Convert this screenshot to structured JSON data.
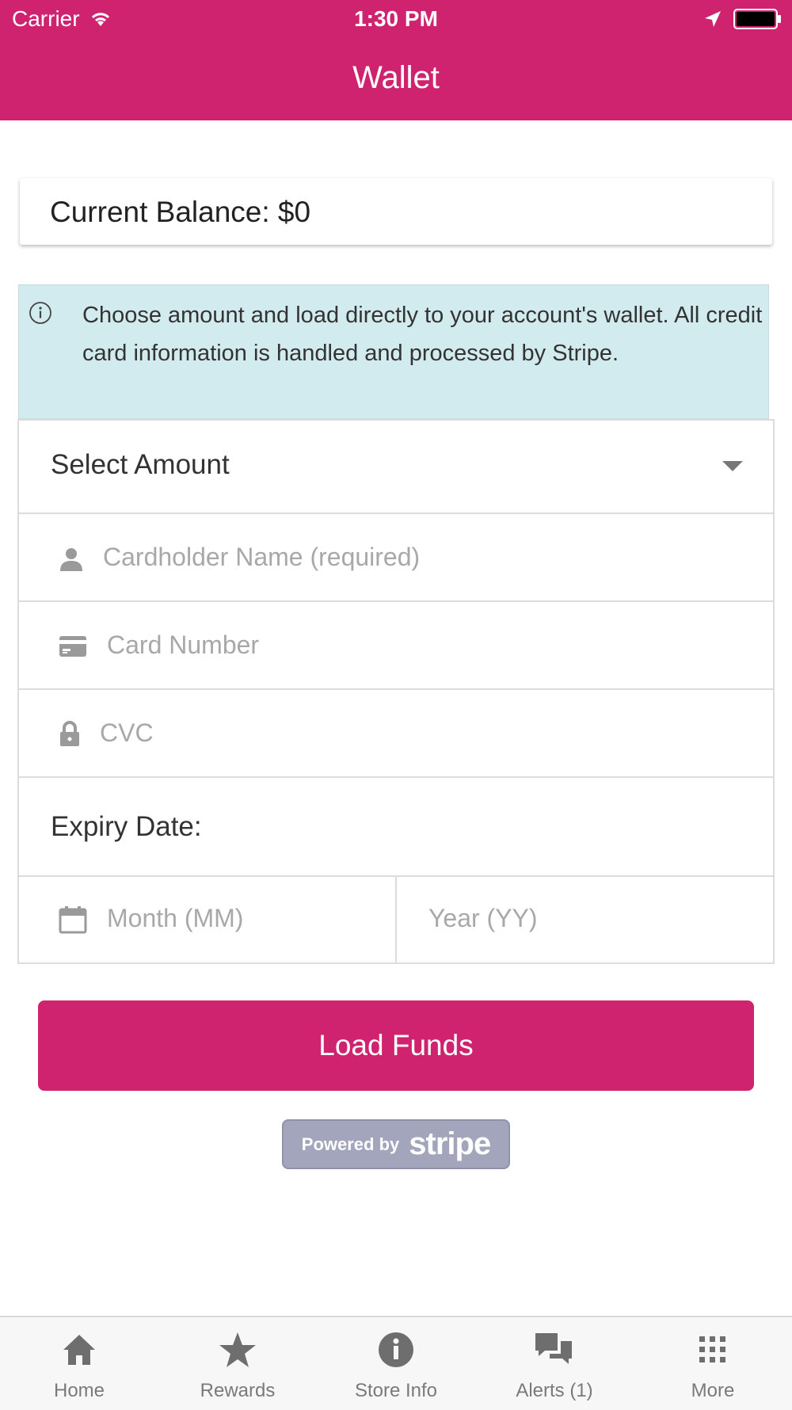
{
  "status_bar": {
    "carrier": "Carrier",
    "time": "1:30 PM"
  },
  "nav": {
    "title": "Wallet"
  },
  "balance": {
    "text": "Current Balance: $0"
  },
  "info": {
    "icon": "info-circle-icon",
    "text": "Choose amount and load directly to your account's wallet. All credit card information is handled and processed by Stripe."
  },
  "form": {
    "select_amount": "Select Amount",
    "cardholder_placeholder": "Cardholder Name (required)",
    "card_number_placeholder": "Card Number",
    "cvc_placeholder": "CVC",
    "expiry_label": "Expiry Date:",
    "month_placeholder": "Month (MM)",
    "year_placeholder": "Year (YY)"
  },
  "actions": {
    "load_funds": "Load Funds"
  },
  "stripe_badge": {
    "small": "Powered by",
    "big": "stripe"
  },
  "tabs": [
    {
      "label": "Home",
      "icon": "home-icon"
    },
    {
      "label": "Rewards",
      "icon": "star-icon"
    },
    {
      "label": "Store Info",
      "icon": "info-icon"
    },
    {
      "label": "Alerts (1)",
      "icon": "chat-bubbles-icon"
    },
    {
      "label": "More",
      "icon": "grid-icon"
    }
  ],
  "colors": {
    "brand": "#cf2370",
    "info_bg": "#d2ebef",
    "tab_icon": "#6e6e6e"
  }
}
